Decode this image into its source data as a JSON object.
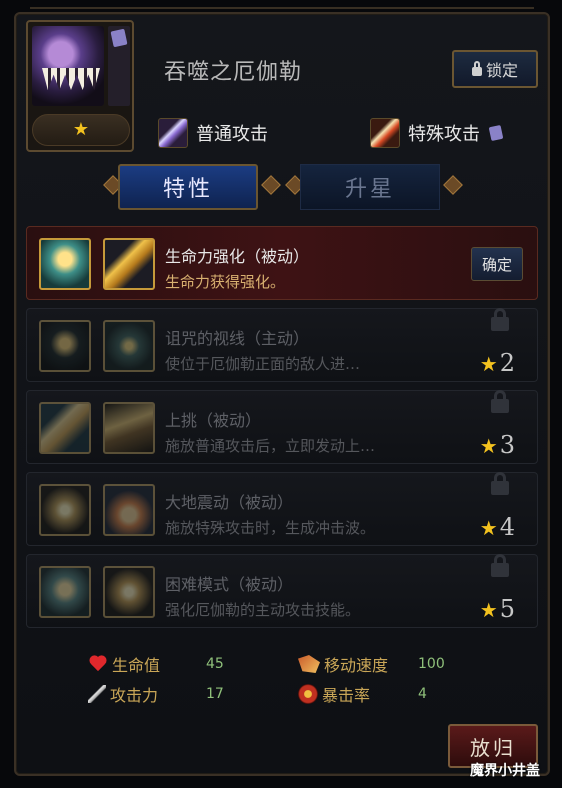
{
  "character": {
    "name": "吞噬之厄伽勒",
    "portrait_stars": "★",
    "lock_label": "锁定"
  },
  "attacks": {
    "normal": "普通攻击",
    "special": "特殊攻击"
  },
  "tabs": [
    {
      "label": "特性",
      "active": true
    },
    {
      "label": "升星",
      "active": false
    }
  ],
  "skills": [
    {
      "title": "生命力强化（被动）",
      "desc": "生命力获得强化。",
      "action": "确定",
      "locked": false
    },
    {
      "title": "诅咒的视线（主动）",
      "desc": "使位于厄伽勒正面的敌人进…",
      "req_star": "★",
      "req": "2",
      "locked": true
    },
    {
      "title": "上挑（被动）",
      "desc": "施放普通攻击后，立即发动上…",
      "req_star": "★",
      "req": "3",
      "locked": true
    },
    {
      "title": "大地震动（被动）",
      "desc": "施放特殊攻击时，生成冲击波。",
      "req_star": "★",
      "req": "4",
      "locked": true
    },
    {
      "title": "困难模式（被动）",
      "desc": "强化厄伽勒的主动攻击技能。",
      "req_star": "★",
      "req": "5",
      "locked": true
    }
  ],
  "stats": {
    "hp_label": "生命值",
    "hp": "45",
    "atk_label": "攻击力",
    "atk": "17",
    "speed_label": "移动速度",
    "speed": "100",
    "crit_label": "暴击率",
    "crit": "4"
  },
  "return_label": "放归",
  "watermark": "魔界小井盖",
  "colors": {
    "accent_gold": "#c69a3a",
    "active_tab": "#1b3c82",
    "star": "#f3c21f",
    "stat_value": "#8fc07a"
  }
}
